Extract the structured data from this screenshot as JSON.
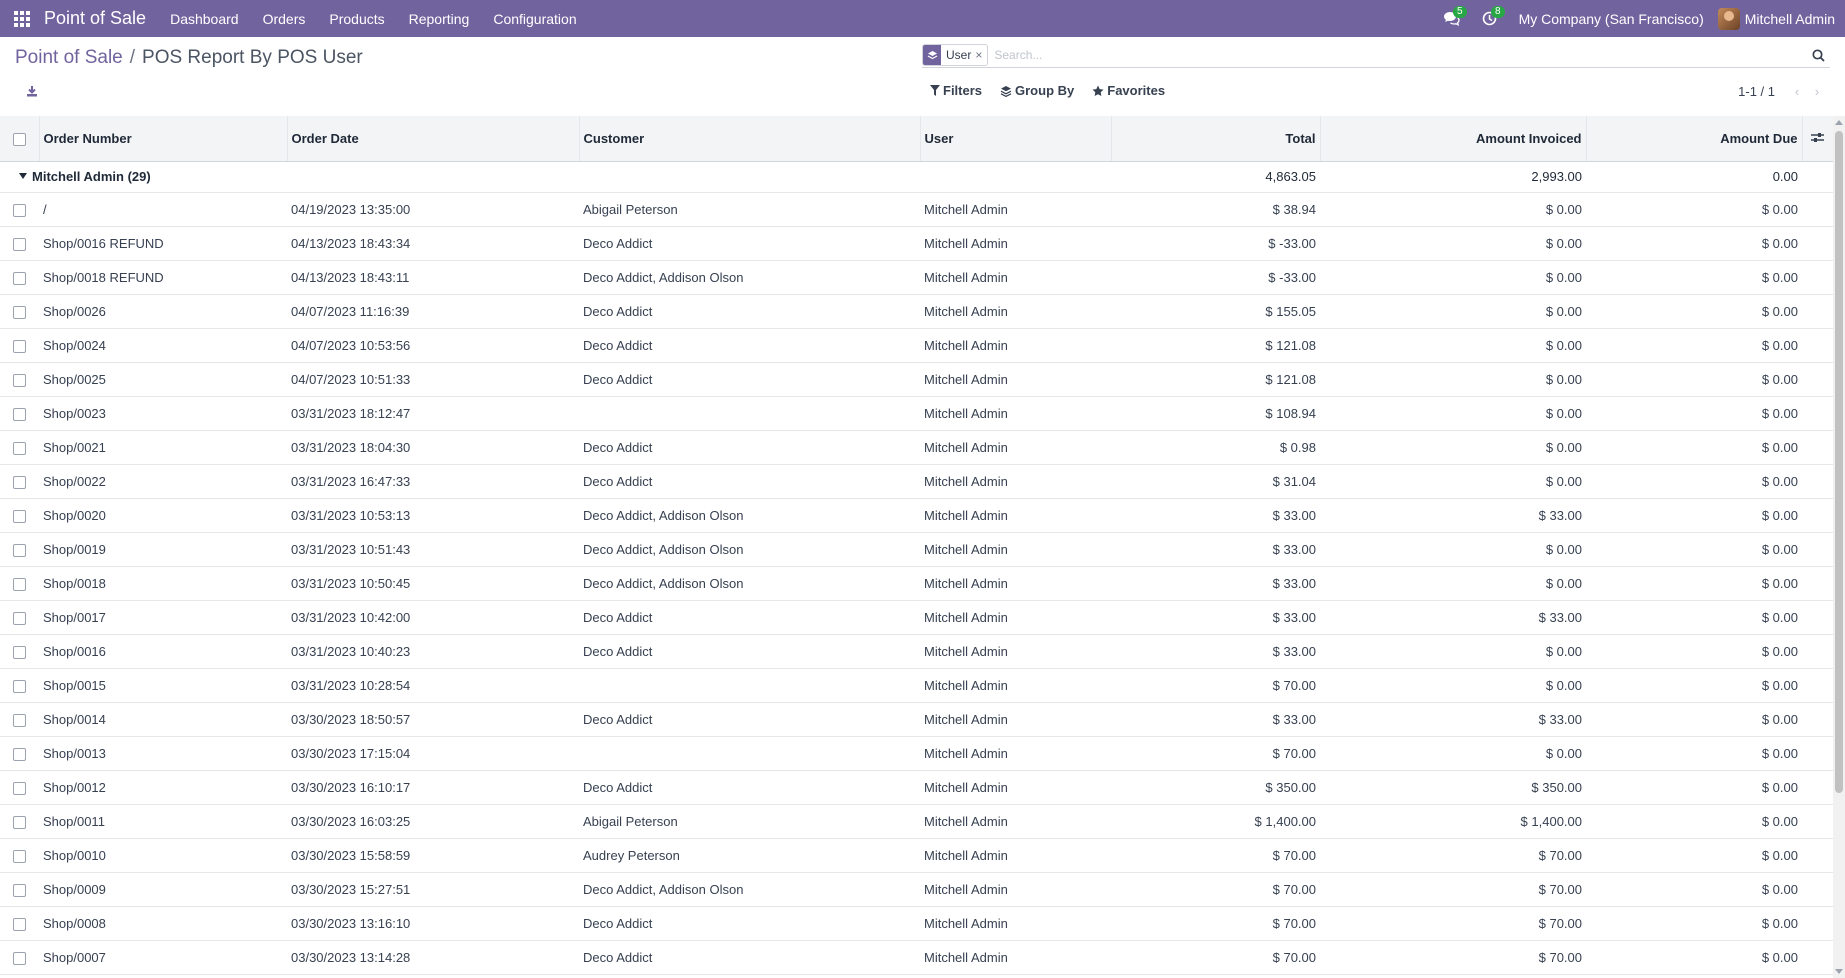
{
  "navbar": {
    "brand": "Point of Sale",
    "menu": [
      "Dashboard",
      "Orders",
      "Products",
      "Reporting",
      "Configuration"
    ],
    "messages_count": "5",
    "activities_count": "8",
    "company": "My Company (San Francisco)",
    "user": "Mitchell Admin"
  },
  "breadcrumb": {
    "parent": "Point of Sale",
    "separator": "/",
    "current": "POS Report By POS User"
  },
  "search": {
    "facet_label": "User",
    "facet_remove": "×",
    "placeholder": "Search..."
  },
  "filters": {
    "filters_label": "Filters",
    "group_by_label": "Group By",
    "favorites_label": "Favorites"
  },
  "pager": {
    "value": "1-1 / 1",
    "prev": "‹",
    "next": "›"
  },
  "table": {
    "columns": [
      "Order Number",
      "Order Date",
      "Customer",
      "User",
      "Total",
      "Amount Invoiced",
      "Amount Due"
    ],
    "group": {
      "label": "Mitchell Admin (29)",
      "total": "4,863.05",
      "invoiced": "2,993.00",
      "due": "0.00"
    },
    "rows": [
      {
        "order": "/",
        "date": "04/19/2023 13:35:00",
        "customer": "Abigail Peterson",
        "user": "Mitchell Admin",
        "total": "$ 38.94",
        "invoiced": "$ 0.00",
        "due": "$ 0.00"
      },
      {
        "order": "Shop/0016 REFUND",
        "date": "04/13/2023 18:43:34",
        "customer": "Deco Addict",
        "user": "Mitchell Admin",
        "total": "$ -33.00",
        "invoiced": "$ 0.00",
        "due": "$ 0.00"
      },
      {
        "order": "Shop/0018 REFUND",
        "date": "04/13/2023 18:43:11",
        "customer": "Deco Addict, Addison Olson",
        "user": "Mitchell Admin",
        "total": "$ -33.00",
        "invoiced": "$ 0.00",
        "due": "$ 0.00"
      },
      {
        "order": "Shop/0026",
        "date": "04/07/2023 11:16:39",
        "customer": "Deco Addict",
        "user": "Mitchell Admin",
        "total": "$ 155.05",
        "invoiced": "$ 0.00",
        "due": "$ 0.00"
      },
      {
        "order": "Shop/0024",
        "date": "04/07/2023 10:53:56",
        "customer": "Deco Addict",
        "user": "Mitchell Admin",
        "total": "$ 121.08",
        "invoiced": "$ 0.00",
        "due": "$ 0.00"
      },
      {
        "order": "Shop/0025",
        "date": "04/07/2023 10:51:33",
        "customer": "Deco Addict",
        "user": "Mitchell Admin",
        "total": "$ 121.08",
        "invoiced": "$ 0.00",
        "due": "$ 0.00"
      },
      {
        "order": "Shop/0023",
        "date": "03/31/2023 18:12:47",
        "customer": "",
        "user": "Mitchell Admin",
        "total": "$ 108.94",
        "invoiced": "$ 0.00",
        "due": "$ 0.00"
      },
      {
        "order": "Shop/0021",
        "date": "03/31/2023 18:04:30",
        "customer": "Deco Addict",
        "user": "Mitchell Admin",
        "total": "$ 0.98",
        "invoiced": "$ 0.00",
        "due": "$ 0.00"
      },
      {
        "order": "Shop/0022",
        "date": "03/31/2023 16:47:33",
        "customer": "Deco Addict",
        "user": "Mitchell Admin",
        "total": "$ 31.04",
        "invoiced": "$ 0.00",
        "due": "$ 0.00"
      },
      {
        "order": "Shop/0020",
        "date": "03/31/2023 10:53:13",
        "customer": "Deco Addict, Addison Olson",
        "user": "Mitchell Admin",
        "total": "$ 33.00",
        "invoiced": "$ 33.00",
        "due": "$ 0.00"
      },
      {
        "order": "Shop/0019",
        "date": "03/31/2023 10:51:43",
        "customer": "Deco Addict, Addison Olson",
        "user": "Mitchell Admin",
        "total": "$ 33.00",
        "invoiced": "$ 0.00",
        "due": "$ 0.00"
      },
      {
        "order": "Shop/0018",
        "date": "03/31/2023 10:50:45",
        "customer": "Deco Addict, Addison Olson",
        "user": "Mitchell Admin",
        "total": "$ 33.00",
        "invoiced": "$ 0.00",
        "due": "$ 0.00"
      },
      {
        "order": "Shop/0017",
        "date": "03/31/2023 10:42:00",
        "customer": "Deco Addict",
        "user": "Mitchell Admin",
        "total": "$ 33.00",
        "invoiced": "$ 33.00",
        "due": "$ 0.00"
      },
      {
        "order": "Shop/0016",
        "date": "03/31/2023 10:40:23",
        "customer": "Deco Addict",
        "user": "Mitchell Admin",
        "total": "$ 33.00",
        "invoiced": "$ 0.00",
        "due": "$ 0.00"
      },
      {
        "order": "Shop/0015",
        "date": "03/31/2023 10:28:54",
        "customer": "",
        "user": "Mitchell Admin",
        "total": "$ 70.00",
        "invoiced": "$ 0.00",
        "due": "$ 0.00"
      },
      {
        "order": "Shop/0014",
        "date": "03/30/2023 18:50:57",
        "customer": "Deco Addict",
        "user": "Mitchell Admin",
        "total": "$ 33.00",
        "invoiced": "$ 33.00",
        "due": "$ 0.00"
      },
      {
        "order": "Shop/0013",
        "date": "03/30/2023 17:15:04",
        "customer": "",
        "user": "Mitchell Admin",
        "total": "$ 70.00",
        "invoiced": "$ 0.00",
        "due": "$ 0.00"
      },
      {
        "order": "Shop/0012",
        "date": "03/30/2023 16:10:17",
        "customer": "Deco Addict",
        "user": "Mitchell Admin",
        "total": "$ 350.00",
        "invoiced": "$ 350.00",
        "due": "$ 0.00"
      },
      {
        "order": "Shop/0011",
        "date": "03/30/2023 16:03:25",
        "customer": "Abigail Peterson",
        "user": "Mitchell Admin",
        "total": "$ 1,400.00",
        "invoiced": "$ 1,400.00",
        "due": "$ 0.00"
      },
      {
        "order": "Shop/0010",
        "date": "03/30/2023 15:58:59",
        "customer": "Audrey Peterson",
        "user": "Mitchell Admin",
        "total": "$ 70.00",
        "invoiced": "$ 70.00",
        "due": "$ 0.00"
      },
      {
        "order": "Shop/0009",
        "date": "03/30/2023 15:27:51",
        "customer": "Deco Addict, Addison Olson",
        "user": "Mitchell Admin",
        "total": "$ 70.00",
        "invoiced": "$ 70.00",
        "due": "$ 0.00"
      },
      {
        "order": "Shop/0008",
        "date": "03/30/2023 13:16:10",
        "customer": "Deco Addict",
        "user": "Mitchell Admin",
        "total": "$ 70.00",
        "invoiced": "$ 70.00",
        "due": "$ 0.00"
      },
      {
        "order": "Shop/0007",
        "date": "03/30/2023 13:14:28",
        "customer": "Deco Addict",
        "user": "Mitchell Admin",
        "total": "$ 70.00",
        "invoiced": "$ 70.00",
        "due": "$ 0.00"
      }
    ]
  },
  "colors": {
    "navbar": "#71639e",
    "badge": "#28a745",
    "header_bg": "#f3f4f6"
  }
}
